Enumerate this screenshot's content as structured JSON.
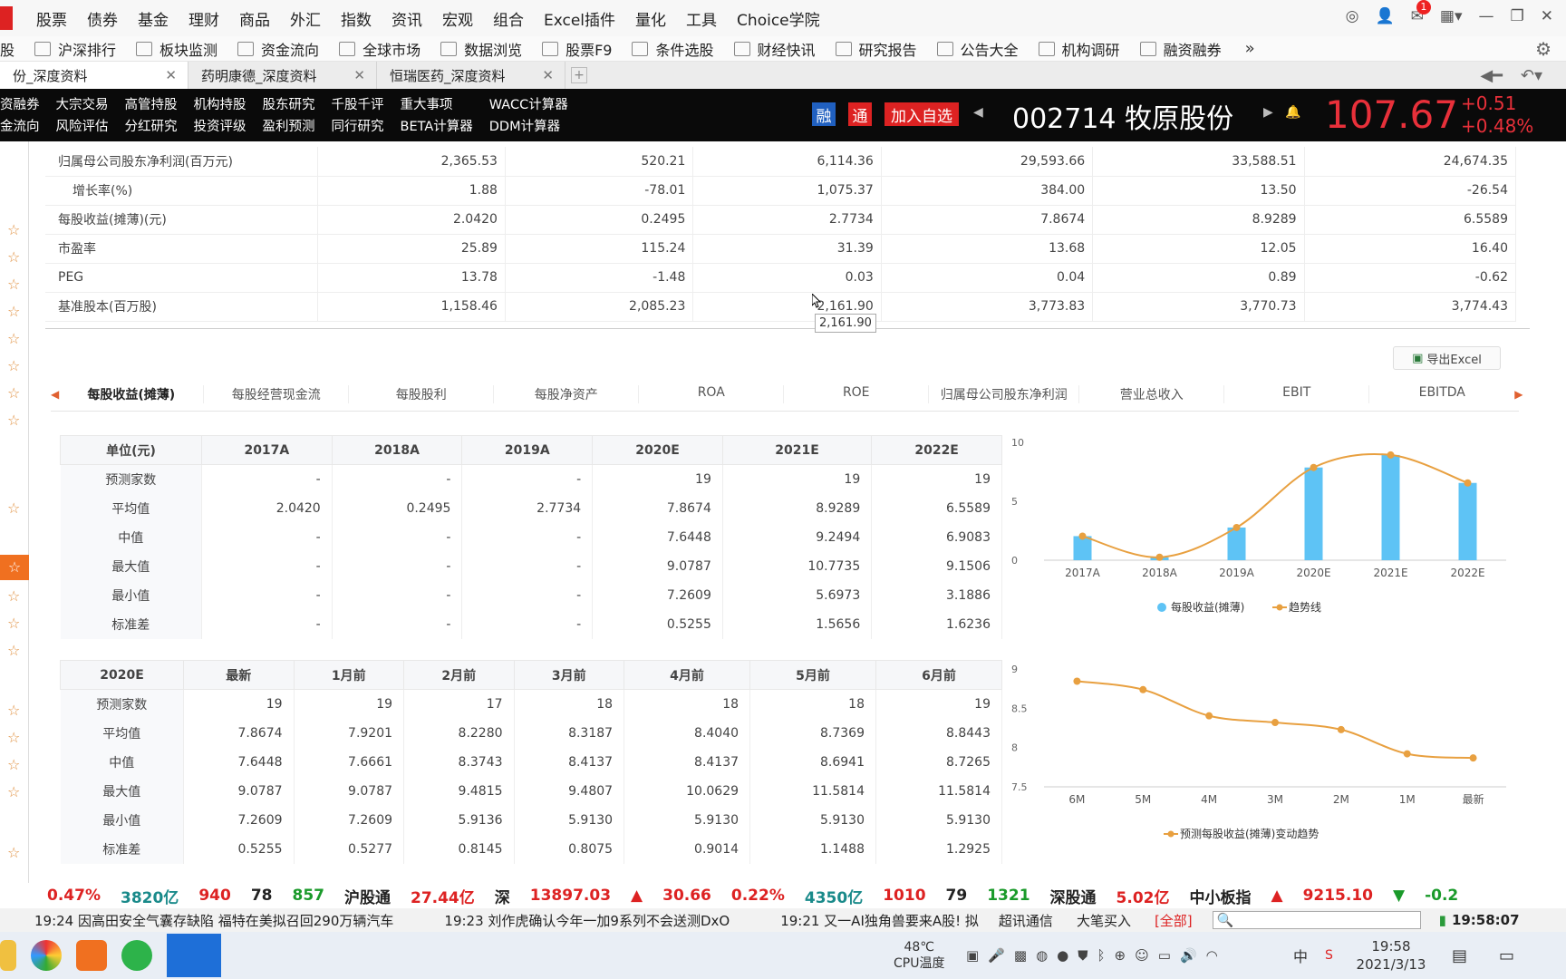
{
  "menu": [
    "股票",
    "债券",
    "基金",
    "理财",
    "商品",
    "外汇",
    "指数",
    "资讯",
    "宏观",
    "组合",
    "Excel插件",
    "量化",
    "工具",
    "Choice学院"
  ],
  "notify_count": "1",
  "toolbar": [
    "股",
    "沪深排行",
    "板块监测",
    "资金流向",
    "全球市场",
    "数据浏览",
    "股票F9",
    "条件选股",
    "财经快讯",
    "研究报告",
    "公告大全",
    "机构调研",
    "融资融券"
  ],
  "tabs": [
    {
      "label": "份_深度资料"
    },
    {
      "label": "药明康德_深度资料"
    },
    {
      "label": "恒瑞医药_深度资料"
    }
  ],
  "links_row1": [
    "资融券",
    "大宗交易",
    "高管持股",
    "机构持股",
    "股东研究",
    "千股千评",
    "重大事项",
    "WACC计算器"
  ],
  "links_row2": [
    "金流向",
    "风险评估",
    "分红研究",
    "投资评级",
    "盈利预测",
    "同行研究",
    "BETA计算器",
    "DDM计算器"
  ],
  "tags": {
    "rong": "融",
    "tong": "通",
    "add": "加入自选"
  },
  "stock": {
    "code": "002714",
    "name": "牧原股份",
    "price": "107.67",
    "change": "+0.51",
    "pct": "+0.48%"
  },
  "top_rows": [
    {
      "label": "归属母公司股东净利润(百万元)",
      "v": [
        "2,365.53",
        "520.21",
        "6,114.36",
        "29,593.66",
        "33,588.51",
        "24,674.35"
      ]
    },
    {
      "label": "增长率(%)",
      "v": [
        "1.88",
        "-78.01",
        "1,075.37",
        "384.00",
        "13.50",
        "-26.54"
      ]
    },
    {
      "label": "每股收益(摊薄)(元)",
      "v": [
        "2.0420",
        "0.2495",
        "2.7734",
        "7.8674",
        "8.9289",
        "6.5589"
      ]
    },
    {
      "label": "市盈率",
      "v": [
        "25.89",
        "115.24",
        "31.39",
        "13.68",
        "12.05",
        "16.40"
      ]
    },
    {
      "label": "PEG",
      "v": [
        "13.78",
        "-1.48",
        "0.03",
        "0.04",
        "0.89",
        "-0.62"
      ]
    },
    {
      "label": "基准股本(百万股)",
      "v": [
        "1,158.46",
        "2,085.23",
        "2,161.90",
        "3,773.83",
        "3,770.73",
        "3,774.43"
      ]
    }
  ],
  "tooltip": "2,161.90",
  "export_label": "导出Excel",
  "subtabs": [
    "每股收益(摊薄)",
    "每股经营现金流",
    "每股股利",
    "每股净资产",
    "ROA",
    "ROE",
    "归属母公司股东净利润",
    "营业总收入",
    "EBIT",
    "EBITDA"
  ],
  "table1": {
    "headers": [
      "单位(元)",
      "2017A",
      "2018A",
      "2019A",
      "2020E",
      "2021E",
      "2022E"
    ],
    "rows": [
      [
        "预测家数",
        "-",
        "-",
        "-",
        "19",
        "19",
        "19"
      ],
      [
        "平均值",
        "2.0420",
        "0.2495",
        "2.7734",
        "7.8674",
        "8.9289",
        "6.5589"
      ],
      [
        "中值",
        "-",
        "-",
        "-",
        "7.6448",
        "9.2494",
        "6.9083"
      ],
      [
        "最大值",
        "-",
        "-",
        "-",
        "9.0787",
        "10.7735",
        "9.1506"
      ],
      [
        "最小值",
        "-",
        "-",
        "-",
        "7.2609",
        "5.6973",
        "3.1886"
      ],
      [
        "标准差",
        "-",
        "-",
        "-",
        "0.5255",
        "1.5656",
        "1.6236"
      ]
    ]
  },
  "table2": {
    "headers": [
      "2020E",
      "最新",
      "1月前",
      "2月前",
      "3月前",
      "4月前",
      "5月前",
      "6月前"
    ],
    "rows": [
      [
        "预测家数",
        "19",
        "19",
        "17",
        "18",
        "18",
        "18",
        "19"
      ],
      [
        "平均值",
        "7.8674",
        "7.9201",
        "8.2280",
        "8.3187",
        "8.4040",
        "8.7369",
        "8.8443"
      ],
      [
        "中值",
        "7.6448",
        "7.6661",
        "8.3743",
        "8.4137",
        "8.4137",
        "8.6941",
        "8.7265"
      ],
      [
        "最大值",
        "9.0787",
        "9.0787",
        "9.4815",
        "9.4807",
        "10.0629",
        "11.5814",
        "11.5814"
      ],
      [
        "最小值",
        "7.2609",
        "7.2609",
        "5.9136",
        "5.9130",
        "5.9130",
        "5.9130",
        "5.9130"
      ],
      [
        "标准差",
        "0.5255",
        "0.5277",
        "0.8145",
        "0.8075",
        "0.9014",
        "1.1488",
        "1.2925"
      ]
    ]
  },
  "chart_data": [
    {
      "type": "bar",
      "categories": [
        "2017A",
        "2018A",
        "2019A",
        "2020E",
        "2021E",
        "2022E"
      ],
      "series": [
        {
          "name": "每股收益(摊薄)",
          "values": [
            2.042,
            0.2495,
            2.7734,
            7.8674,
            8.9289,
            6.5589
          ],
          "color": "#5ec3f5"
        },
        {
          "name": "趋势线",
          "values": [
            2.042,
            0.2495,
            2.7734,
            7.8674,
            8.9289,
            6.5589
          ],
          "color": "#e8a040"
        }
      ],
      "ylim": [
        0,
        10
      ],
      "yticks": [
        "0",
        "5",
        "10"
      ]
    },
    {
      "type": "line",
      "categories": [
        "6M",
        "5M",
        "4M",
        "3M",
        "2M",
        "1M",
        "最新"
      ],
      "series": [
        {
          "name": "预测每股收益(摊薄)变动趋势",
          "values": [
            8.8443,
            8.7369,
            8.404,
            8.3187,
            8.228,
            7.9201,
            7.8674
          ],
          "color": "#e8a040"
        }
      ],
      "ylim": [
        7.5,
        9
      ],
      "yticks": [
        "7.5",
        "8",
        "8.5",
        "9"
      ]
    }
  ],
  "ticker": [
    {
      "t": "0.47%",
      "c": "#d22"
    },
    {
      "t": "3820亿",
      "c": "#1a8a8a"
    },
    {
      "t": "940",
      "c": "#d22"
    },
    {
      "t": "78",
      "c": "#222"
    },
    {
      "t": "857",
      "c": "#1a9a2a"
    },
    {
      "t": "沪股通",
      "c": "#222"
    },
    {
      "t": "27.44亿",
      "c": "#d22"
    },
    {
      "t": "深",
      "c": "#222"
    },
    {
      "t": "13897.03",
      "c": "#d22"
    },
    {
      "t": "▲",
      "c": "#d22"
    },
    {
      "t": "30.66",
      "c": "#d22"
    },
    {
      "t": "0.22%",
      "c": "#d22"
    },
    {
      "t": "4350亿",
      "c": "#1a8a8a"
    },
    {
      "t": "1010",
      "c": "#d22"
    },
    {
      "t": "79",
      "c": "#222"
    },
    {
      "t": "1321",
      "c": "#1a9a2a"
    },
    {
      "t": "深股通",
      "c": "#222"
    },
    {
      "t": "5.02亿",
      "c": "#d22"
    },
    {
      "t": "中小板指",
      "c": "#222"
    },
    {
      "t": "▲",
      "c": "#d22"
    },
    {
      "t": "9215.10",
      "c": "#d22"
    },
    {
      "t": "▼",
      "c": "#1a9a2a"
    },
    {
      "t": "-0.2",
      "c": "#1a9a2a"
    }
  ],
  "news": [
    "19:24 因高田安全气囊存缺陷 福特在美拟召回290万辆汽车",
    "19:23 刘作虎确认今年一加9系列不会送测DxO",
    "19:21 又一AI独角兽要来A股! 拟",
    "超讯通信",
    "大笔买入",
    "[全部]"
  ],
  "clock_small": "19:58:07",
  "taskbar": {
    "temp": "48℃",
    "temp_label": "CPU温度",
    "time": "19:58",
    "date": "2021/3/13",
    "ime": "中"
  }
}
